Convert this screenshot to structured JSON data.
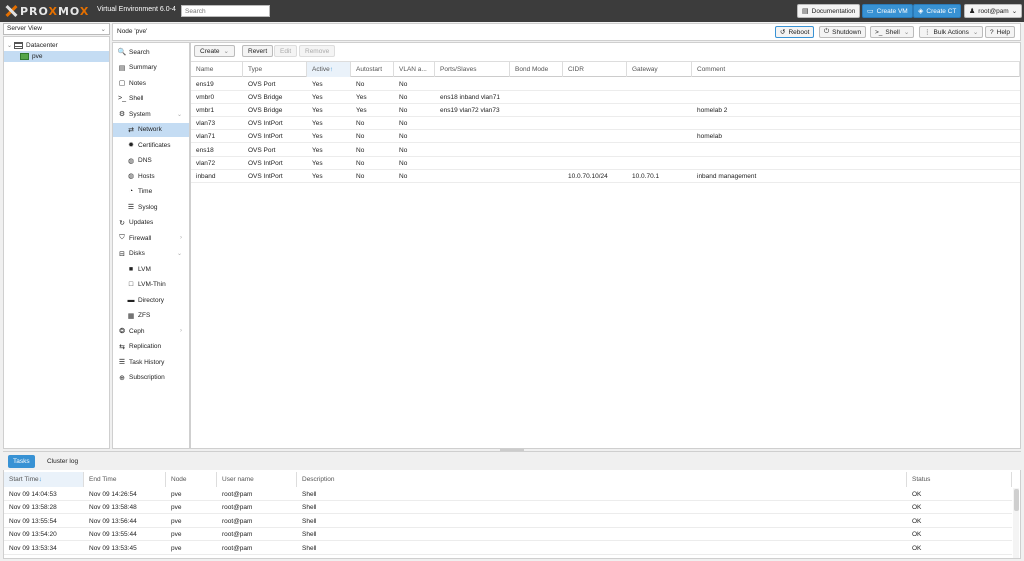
{
  "topbar": {
    "logo_prefix": "PRO",
    "logo_o": "X",
    "logo_suffix": "MO",
    "logo_end": "X",
    "version": "Virtual Environment 6.0-4",
    "search_placeholder": "Search",
    "documentation": "Documentation",
    "create_vm": "Create VM",
    "create_ct": "Create CT",
    "user": "root@pam"
  },
  "left": {
    "view_select": "Server View",
    "tree": [
      {
        "label": "Datacenter",
        "icon": "datacenter-icon"
      },
      {
        "label": "pve",
        "icon": "node-icon"
      }
    ]
  },
  "header": {
    "breadcrumb": "Node 'pve'",
    "reboot": "Reboot",
    "shutdown": "Shutdown",
    "shell": "Shell",
    "bulk_actions": "Bulk Actions",
    "help": "Help"
  },
  "nav": [
    {
      "label": "Search",
      "icon": "search-icon",
      "glyph": "🔍"
    },
    {
      "label": "Summary",
      "icon": "book-icon",
      "glyph": "▤"
    },
    {
      "label": "Notes",
      "icon": "notes-icon",
      "glyph": "▢"
    },
    {
      "label": "Shell",
      "icon": "terminal-icon",
      "glyph": ">_"
    },
    {
      "label": "System",
      "icon": "gears-icon",
      "glyph": "⚙"
    },
    {
      "label": "Network",
      "icon": "exchange-icon",
      "glyph": "⇄"
    },
    {
      "label": "Certificates",
      "icon": "certificate-icon",
      "glyph": "✹"
    },
    {
      "label": "DNS",
      "icon": "globe-icon",
      "glyph": "◍"
    },
    {
      "label": "Hosts",
      "icon": "globe-icon",
      "glyph": "◍"
    },
    {
      "label": "Time",
      "icon": "clock-icon",
      "glyph": "◔"
    },
    {
      "label": "Syslog",
      "icon": "list-icon",
      "glyph": "☰"
    },
    {
      "label": "Updates",
      "icon": "refresh-icon",
      "glyph": "↻"
    },
    {
      "label": "Firewall",
      "icon": "shield-icon",
      "glyph": "⛉"
    },
    {
      "label": "Disks",
      "icon": "hdd-icon",
      "glyph": "⊟"
    },
    {
      "label": "LVM",
      "icon": "square-icon",
      "glyph": "■"
    },
    {
      "label": "LVM-Thin",
      "icon": "square-outline-icon",
      "glyph": "□"
    },
    {
      "label": "Directory",
      "icon": "folder-icon",
      "glyph": "▬"
    },
    {
      "label": "ZFS",
      "icon": "th-large-icon",
      "glyph": "▦"
    },
    {
      "label": "Ceph",
      "icon": "ceph-icon",
      "glyph": "❂"
    },
    {
      "label": "Replication",
      "icon": "retweet-icon",
      "glyph": "⇆"
    },
    {
      "label": "Task History",
      "icon": "list-alt-icon",
      "glyph": "☰"
    },
    {
      "label": "Subscription",
      "icon": "support-icon",
      "glyph": "⊕"
    }
  ],
  "toolbar": {
    "create": "Create",
    "revert": "Revert",
    "edit": "Edit",
    "remove": "Remove"
  },
  "network_table": {
    "columns": [
      "Name",
      "Type",
      "Active",
      "Autostart",
      "VLAN a...",
      "Ports/Slaves",
      "Bond Mode",
      "CIDR",
      "Gateway",
      "Comment"
    ],
    "rows": [
      [
        "ens19",
        "OVS Port",
        "Yes",
        "No",
        "No",
        "",
        "",
        "",
        "",
        ""
      ],
      [
        "vmbr0",
        "OVS Bridge",
        "Yes",
        "Yes",
        "No",
        "ens18 inband vlan71",
        "",
        "",
        "",
        ""
      ],
      [
        "vmbr1",
        "OVS Bridge",
        "Yes",
        "Yes",
        "No",
        "ens19 vlan72 vlan73",
        "",
        "",
        "",
        "homelab 2"
      ],
      [
        "vlan73",
        "OVS IntPort",
        "Yes",
        "No",
        "No",
        "",
        "",
        "",
        "",
        ""
      ],
      [
        "vlan71",
        "OVS IntPort",
        "Yes",
        "No",
        "No",
        "",
        "",
        "",
        "",
        "homelab"
      ],
      [
        "ens18",
        "OVS Port",
        "Yes",
        "No",
        "No",
        "",
        "",
        "",
        "",
        ""
      ],
      [
        "vlan72",
        "OVS IntPort",
        "Yes",
        "No",
        "No",
        "",
        "",
        "",
        "",
        ""
      ],
      [
        "inband",
        "OVS IntPort",
        "Yes",
        "No",
        "No",
        "",
        "",
        "10.0.70.10/24",
        "10.0.70.1",
        "inband management"
      ]
    ]
  },
  "tasks": {
    "tabs": [
      "Tasks",
      "Cluster log"
    ],
    "columns": [
      "Start Time",
      "End Time",
      "Node",
      "User name",
      "Description",
      "Status"
    ],
    "rows": [
      [
        "Nov 09 14:04:53",
        "Nov 09 14:26:54",
        "pve",
        "root@pam",
        "Shell",
        "OK"
      ],
      [
        "Nov 09 13:58:28",
        "Nov 09 13:58:48",
        "pve",
        "root@pam",
        "Shell",
        "OK"
      ],
      [
        "Nov 09 13:55:54",
        "Nov 09 13:56:44",
        "pve",
        "root@pam",
        "Shell",
        "OK"
      ],
      [
        "Nov 09 13:54:20",
        "Nov 09 13:55:44",
        "pve",
        "root@pam",
        "Shell",
        "OK"
      ],
      [
        "Nov 09 13:53:34",
        "Nov 09 13:53:45",
        "pve",
        "root@pam",
        "Shell",
        "OK"
      ]
    ]
  },
  "colors": {
    "accent": "#3892d4",
    "brand_orange": "#e57000",
    "selected": "#c4dcf3"
  }
}
